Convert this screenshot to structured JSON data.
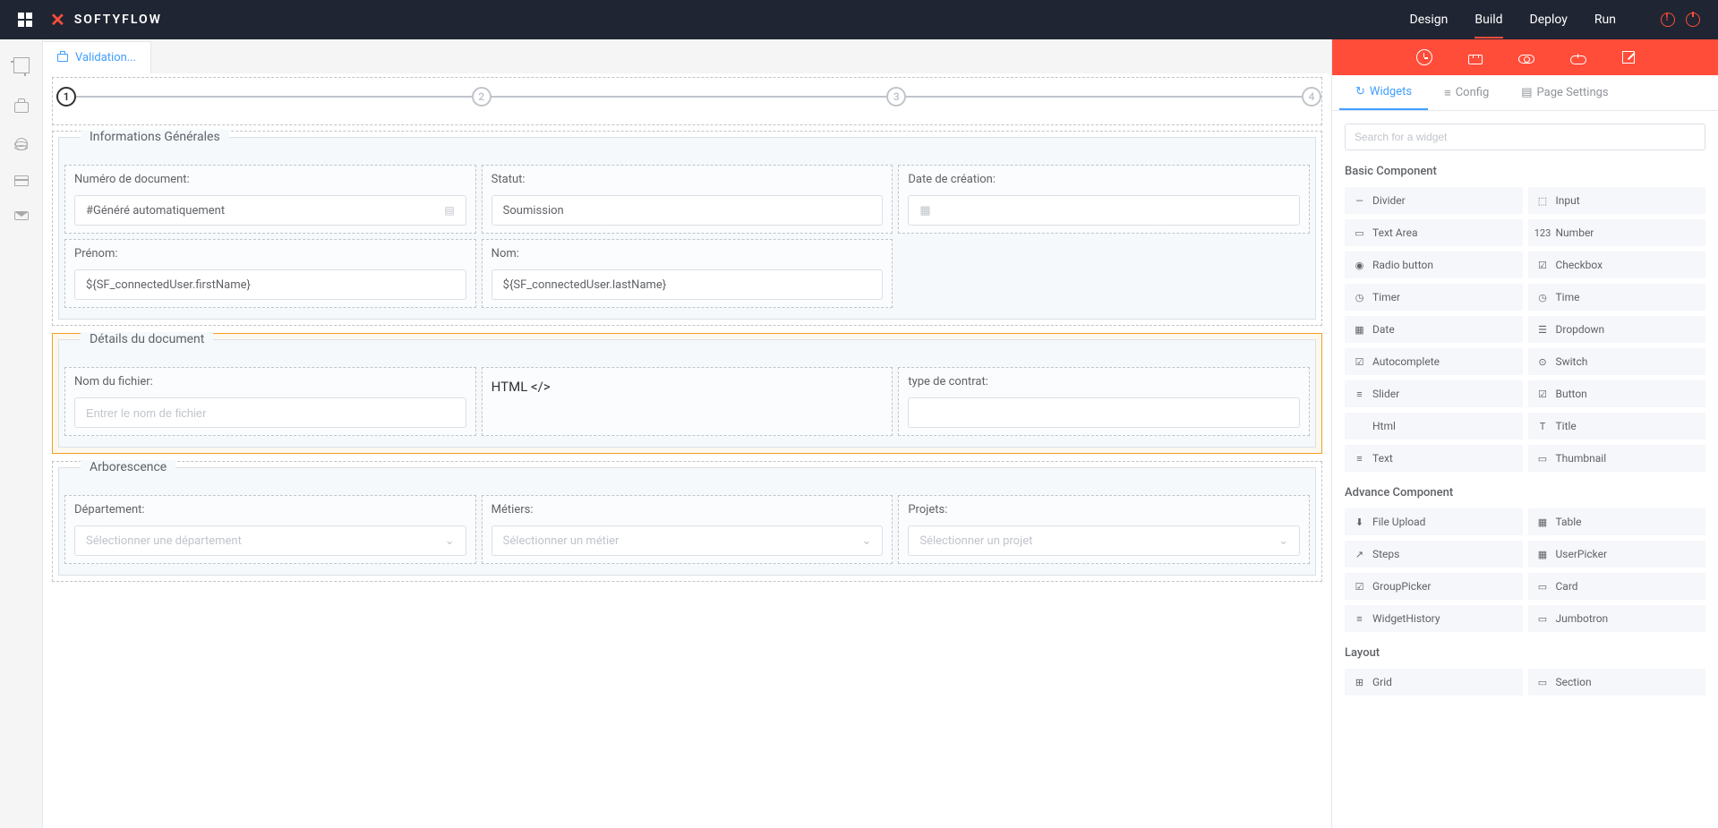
{
  "brand": "SOFTYFLOW",
  "navbar": {
    "links": [
      "Design",
      "Build",
      "Deploy",
      "Run"
    ],
    "active": "Build"
  },
  "tab": {
    "label": "Validation..."
  },
  "steps": {
    "count": 4,
    "active": 1
  },
  "sectionGeneral": {
    "legend": "Informations Générales",
    "docNumLabel": "Numéro de document:",
    "docNumValue": "#Généré automatiquement",
    "statusLabel": "Statut:",
    "statusValue": "Soumission",
    "createdLabel": "Date de création:",
    "firstNameLabel": "Prénom:",
    "firstNameValue": "${SF_connectedUser.firstName}",
    "lastNameLabel": "Nom:",
    "lastNameValue": "${SF_connectedUser.lastName}"
  },
  "sectionDetails": {
    "legend": "Détails du document",
    "fileNameLabel": "Nom du fichier:",
    "fileNamePlaceholder": "Entrer le nom de fichier",
    "htmlLabel": "HTML </>",
    "contractTypeLabel": "type de contrat:"
  },
  "sectionTree": {
    "legend": "Arborescence",
    "deptLabel": "Département:",
    "deptPlaceholder": "Sélectionner une département",
    "jobLabel": "Métiers:",
    "jobPlaceholder": "Sélectionner un métier",
    "projectLabel": "Projets:",
    "projectPlaceholder": "Sélectionner un projet"
  },
  "rightPanel": {
    "tabs": {
      "widgets": "Widgets",
      "config": "Config",
      "pageSettings": "Page Settings"
    },
    "searchPlaceholder": "Search for a widget",
    "groups": {
      "basic": "Basic Component",
      "advance": "Advance Component",
      "layout": "Layout"
    },
    "basicWidgets": [
      {
        "icon": "—",
        "name": "Divider"
      },
      {
        "icon": "⬚",
        "name": "Input"
      },
      {
        "icon": "▭",
        "name": "Text Area"
      },
      {
        "icon": "123",
        "name": "Number"
      },
      {
        "icon": "◉",
        "name": "Radio button"
      },
      {
        "icon": "☑",
        "name": "Checkbox"
      },
      {
        "icon": "◷",
        "name": "Timer"
      },
      {
        "icon": "◷",
        "name": "Time"
      },
      {
        "icon": "▦",
        "name": "Date"
      },
      {
        "icon": "☰",
        "name": "Dropdown"
      },
      {
        "icon": "☑",
        "name": "Autocomplete"
      },
      {
        "icon": "⊙",
        "name": "Switch"
      },
      {
        "icon": "≡",
        "name": "Slider"
      },
      {
        "icon": "☑",
        "name": "Button"
      },
      {
        "icon": "</>",
        "name": "Html"
      },
      {
        "icon": "T",
        "name": "Title"
      },
      {
        "icon": "≡",
        "name": "Text"
      },
      {
        "icon": "▭",
        "name": "Thumbnail"
      }
    ],
    "advanceWidgets": [
      {
        "icon": "⬇",
        "name": "File Upload"
      },
      {
        "icon": "▦",
        "name": "Table"
      },
      {
        "icon": "↗",
        "name": "Steps"
      },
      {
        "icon": "▦",
        "name": "UserPicker"
      },
      {
        "icon": "☑",
        "name": "GroupPicker"
      },
      {
        "icon": "▭",
        "name": "Card"
      },
      {
        "icon": "≡",
        "name": "WidgetHistory"
      },
      {
        "icon": "▭",
        "name": "Jumbotron"
      }
    ],
    "layoutWidgets": [
      {
        "icon": "⊞",
        "name": "Grid"
      },
      {
        "icon": "▭",
        "name": "Section"
      }
    ]
  }
}
